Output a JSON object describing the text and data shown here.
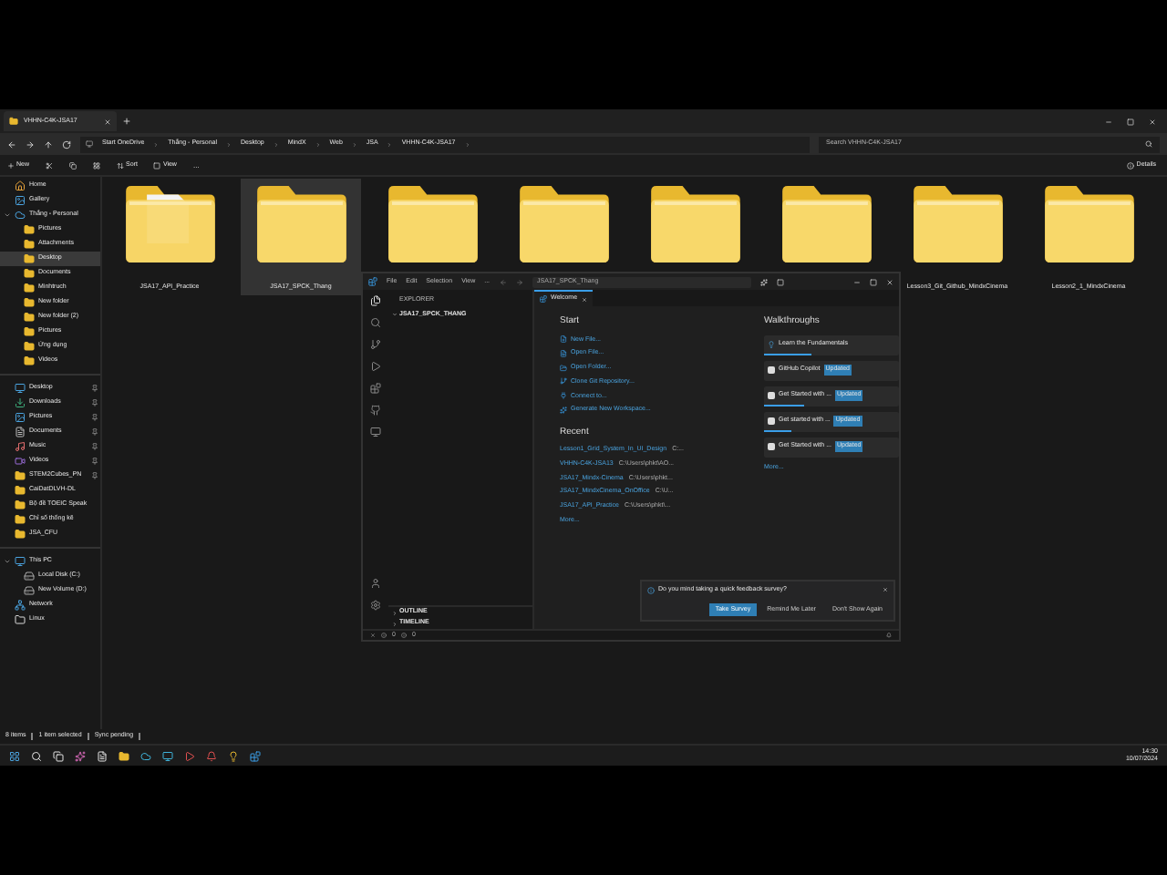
{
  "explorer": {
    "tab_title": "VHHN-C4K-JSA17",
    "breadcrumb": [
      "Start OneDrive",
      "Thắng - Personal",
      "Desktop",
      "MindX",
      "Web",
      "JSA",
      "VHHN-C4K-JSA17"
    ],
    "search": {
      "placeholder": "Search VHHN-C4K-JSA17"
    },
    "toolbar": {
      "new": "New",
      "sort": "Sort",
      "view": "View",
      "more": "...",
      "details": "Details"
    },
    "sidebar": [
      [
        {
          "label": "Home",
          "selected": false
        },
        {
          "label": "Gallery",
          "selected": false
        },
        {
          "label": "Thắng - Personal",
          "selected": false,
          "expanded": true,
          "children": [
            {
              "label": "Pictures",
              "selected": false
            },
            {
              "label": "Attachments",
              "selected": false
            },
            {
              "label": "Desktop",
              "selected": true
            },
            {
              "label": "Documents",
              "selected": false
            },
            {
              "label": "Minhtruch",
              "selected": false
            },
            {
              "label": "New folder",
              "selected": false
            },
            {
              "label": "New folder (2)",
              "selected": false
            },
            {
              "label": "Pictures",
              "selected": false
            },
            {
              "label": "Ứng dụng",
              "selected": false
            },
            {
              "label": "Videos",
              "selected": false
            }
          ]
        }
      ],
      [
        {
          "label": "Desktop",
          "selected": false,
          "pinned": true
        },
        {
          "label": "Downloads",
          "selected": false,
          "pinned": true
        },
        {
          "label": "Pictures",
          "selected": false,
          "pinned": true
        },
        {
          "label": "Documents",
          "selected": false,
          "pinned": true
        },
        {
          "label": "Music",
          "selected": false,
          "pinned": true
        },
        {
          "label": "Videos",
          "selected": false,
          "pinned": true
        },
        {
          "label": "STEM2Cubes_PN",
          "selected": false,
          "pinned": true
        },
        {
          "label": "CaiDatDLVH-DL",
          "selected": false,
          "pinned": false
        },
        {
          "label": "Bộ đề TOEIC Speak",
          "selected": false,
          "pinned": false
        },
        {
          "label": "Chỉ số thống kê",
          "selected": false,
          "pinned": false
        },
        {
          "label": "JSA_CFU",
          "selected": false,
          "pinned": false
        }
      ],
      [
        {
          "label": "This PC",
          "selected": false,
          "expanded": true,
          "children": [
            {
              "label": "Local Disk (C:)",
              "selected": false
            },
            {
              "label": "New Volume (D:)",
              "selected": false
            }
          ]
        },
        {
          "label": "Network",
          "selected": false
        },
        {
          "label": "Linux",
          "selected": false
        }
      ]
    ],
    "folders": [
      {
        "label": "JSA17_API_Practice",
        "selected": false,
        "kind": "document"
      },
      {
        "label": "JSA17_SPCK_Thang",
        "selected": true,
        "kind": "plain"
      },
      {
        "selected": false,
        "kind": "plain"
      },
      {
        "selected": false,
        "kind": "plain"
      },
      {
        "selected": false,
        "kind": "plain"
      },
      {
        "selected": false,
        "kind": "plain"
      },
      {
        "label": "Lesson3_Git_Github_MindxCinema",
        "selected": false,
        "kind": "plain"
      },
      {
        "label": "Lesson2_1_MindxCinema",
        "selected": false,
        "kind": "plain"
      }
    ],
    "status_bar": [
      "8 items",
      "1 item selected",
      "Sync pending"
    ]
  },
  "taskbar": {
    "time": "14:30",
    "date": "10/07/2024"
  },
  "vscode": {
    "menu": [
      "File",
      "Edit",
      "Selection",
      "View",
      "..."
    ],
    "search": "JSA17_SPCK_Thang",
    "sidebar_title": "EXPLORER",
    "folder": "JSA17_SPCK_THANG",
    "panels": [
      "OUTLINE",
      "TIMELINE"
    ],
    "tab": "Welcome",
    "start_heading": "Start",
    "start": [
      "New File...",
      "Open File...",
      "Open Folder...",
      "Clone Git Repository...",
      "Connect to...",
      "Generate New Workspace..."
    ],
    "recent_heading": "Recent",
    "recent": [
      {
        "name": "Lesson1_Grid_System_In_UI_Design",
        "path": "C:..."
      },
      {
        "name": "VHHN-C4K-JSA13",
        "path": "C:\\Users\\phkt\\AO..."
      },
      {
        "name": "JSA17_Mindx-Cinema",
        "path": "C:\\Users\\phkt..."
      },
      {
        "name": "JSA17_MindxCinema_OnOffice",
        "path": "C:\\U..."
      },
      {
        "name": "JSA17_API_Practice",
        "path": "C:\\Users\\phkt\\..."
      }
    ],
    "recent_more": "More...",
    "walk_heading": "Walkthroughs",
    "walkthroughs": [
      {
        "title": "Learn the Fundamentals",
        "level": 0.35
      },
      {
        "title": "GitHub Copilot",
        "badge": "Updated"
      },
      {
        "title": "Get Started with ...",
        "badge": "Updated",
        "level": 0.3
      },
      {
        "title": "Get started with ...",
        "badge": "Updated",
        "level": 0.2
      },
      {
        "title": "Get Started with ...",
        "badge": "Updated"
      }
    ],
    "walk_more": "More...",
    "notification": {
      "message": "Do you mind taking a quick feedback survey?",
      "buttons": [
        "Take Survey",
        "Remind Me Later",
        "Don't Show Again"
      ]
    },
    "status": {
      "errors": "0",
      "warnings": "0"
    }
  }
}
